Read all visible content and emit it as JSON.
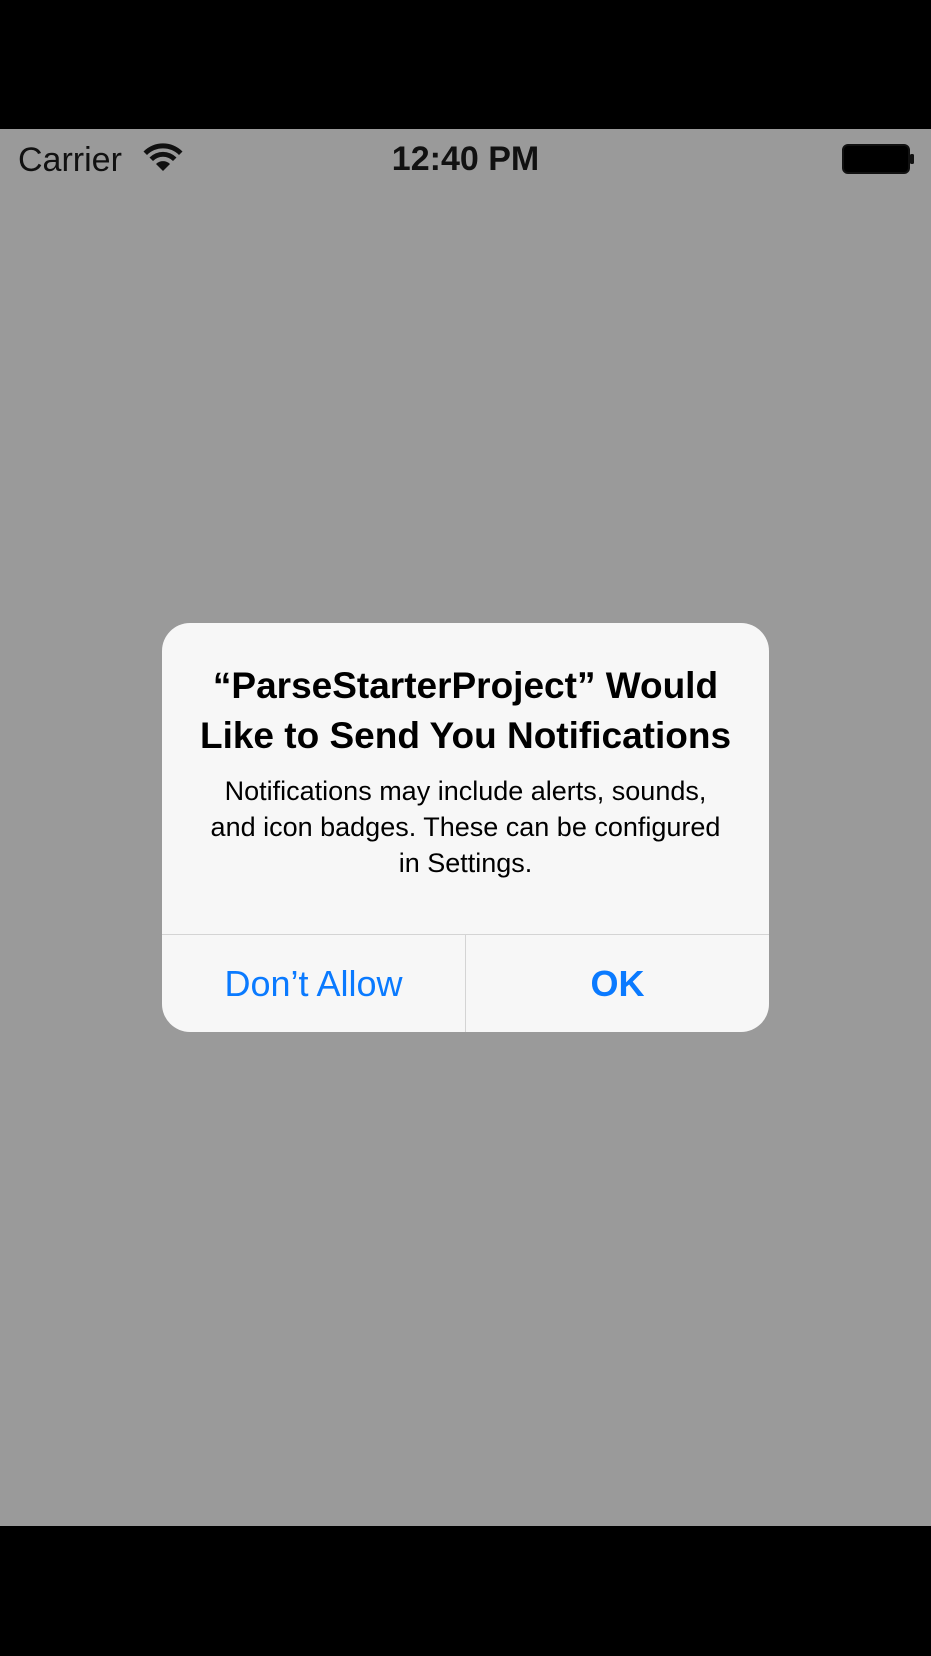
{
  "status_bar": {
    "carrier": "Carrier",
    "time": "12:40 PM",
    "wifi_icon": "wifi-icon",
    "battery_icon": "battery-full-icon"
  },
  "alert": {
    "title": "“ParseStarterProject” Would Like to Send You Notifications",
    "message": "Notifications may include alerts, sounds, and icon badges. These can be configured in Settings.",
    "buttons": {
      "deny_label": "Don’t Allow",
      "ok_label": "OK"
    }
  },
  "colors": {
    "background": "#9a9a9a",
    "alert_background": "#f7f7f7",
    "button_text": "#0a7aff",
    "letterbox": "#000000"
  }
}
